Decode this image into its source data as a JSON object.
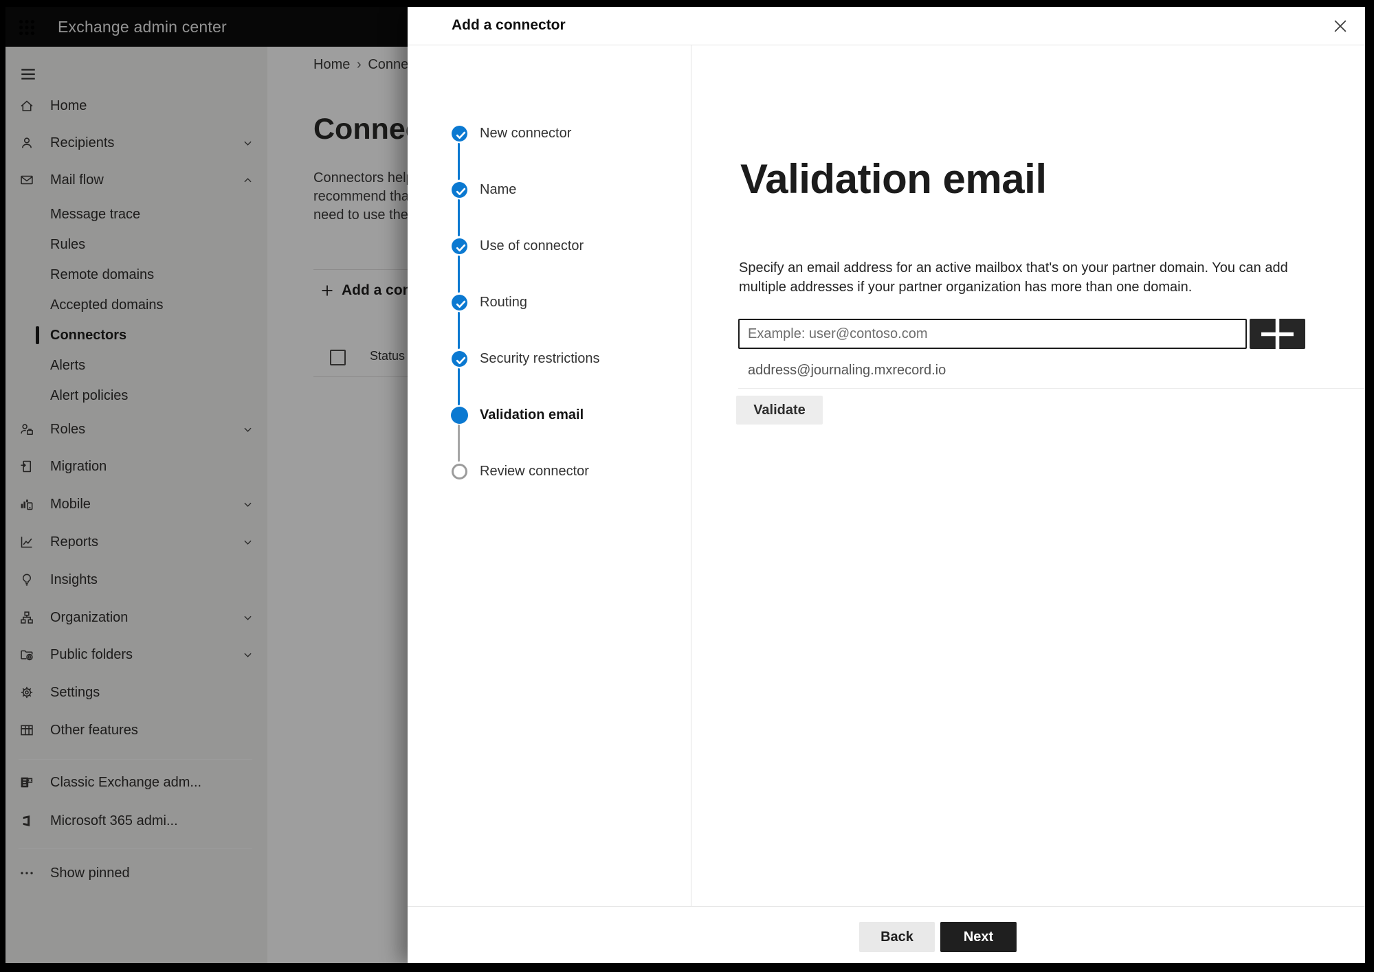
{
  "topbar": {
    "title": "Exchange admin center",
    "app_launcher_icon": "waffle-icon"
  },
  "sidebar": {
    "menu_icon": "hamburger-icon",
    "items": [
      {
        "label": "Home",
        "icon": "home-icon"
      },
      {
        "label": "Recipients",
        "icon": "person-icon",
        "chevron": "down"
      },
      {
        "label": "Mail flow",
        "icon": "mail-icon",
        "chevron": "up"
      },
      {
        "label": "Message trace",
        "sub": true
      },
      {
        "label": "Rules",
        "sub": true
      },
      {
        "label": "Remote domains",
        "sub": true
      },
      {
        "label": "Accepted domains",
        "sub": true
      },
      {
        "label": "Connectors",
        "sub": true,
        "selected": true
      },
      {
        "label": "Alerts",
        "sub": true
      },
      {
        "label": "Alert policies",
        "sub": true
      },
      {
        "label": "Roles",
        "icon": "person-briefcase-icon",
        "chevron": "down"
      },
      {
        "label": "Migration",
        "icon": "migration-icon"
      },
      {
        "label": "Mobile",
        "icon": "mobile-chart-icon",
        "chevron": "down"
      },
      {
        "label": "Reports",
        "icon": "line-chart-icon",
        "chevron": "down"
      },
      {
        "label": "Insights",
        "icon": "lightbulb-icon"
      },
      {
        "label": "Organization",
        "icon": "org-chart-icon",
        "chevron": "down"
      },
      {
        "label": "Public folders",
        "icon": "public-folder-icon",
        "chevron": "down"
      },
      {
        "label": "Settings",
        "icon": "gear-icon"
      },
      {
        "label": "Other features",
        "icon": "grid-icon"
      },
      {
        "divider": true
      },
      {
        "label": "Classic Exchange adm...",
        "icon": "exchange-logo-icon"
      },
      {
        "label": "Microsoft 365 admi...",
        "icon": "office-logo-icon"
      },
      {
        "divider": true
      },
      {
        "label": "Show pinned",
        "icon": "ellipsis-icon"
      }
    ]
  },
  "page": {
    "breadcrumb": {
      "home": "Home",
      "separator": "›",
      "current": "Conne"
    },
    "heading": "Connect",
    "paragraph_lines": [
      "Connectors help",
      "recommend that",
      "need to use ther"
    ],
    "add_button_label": "Add a conn",
    "add_button_icon": "plus-icon",
    "table": {
      "status_header": "Status"
    }
  },
  "dialog": {
    "title": "Add a connector",
    "close_icon": "close-icon",
    "steps": [
      {
        "label": "New connector",
        "state": "completed"
      },
      {
        "label": "Name",
        "state": "completed"
      },
      {
        "label": "Use of connector",
        "state": "completed"
      },
      {
        "label": "Routing",
        "state": "completed"
      },
      {
        "label": "Security restrictions",
        "state": "completed"
      },
      {
        "label": "Validation email",
        "state": "current"
      },
      {
        "label": "Review connector",
        "state": "upcoming"
      }
    ],
    "content": {
      "heading": "Validation email",
      "description_lines": [
        "Specify an email address for an active mailbox that's on your partner domain. You can add",
        "multiple addresses if your partner organization has more than one domain."
      ],
      "email_input": {
        "value": "",
        "placeholder": "Example: user@contoso.com"
      },
      "add_address_icon": "plus-icon",
      "addresses": [
        {
          "email": "address@journaling.mxrecord.io",
          "delete_icon": "trash-icon"
        }
      ],
      "validate_button": "Validate"
    },
    "footer": {
      "back_button": "Back",
      "next_button": "Next"
    }
  },
  "colors": {
    "accent_blue": "#0b79d1",
    "pending_gray": "#a6a6a6",
    "primary_button": "#1f1f1f",
    "topbar_background": "#0c0c0c"
  }
}
